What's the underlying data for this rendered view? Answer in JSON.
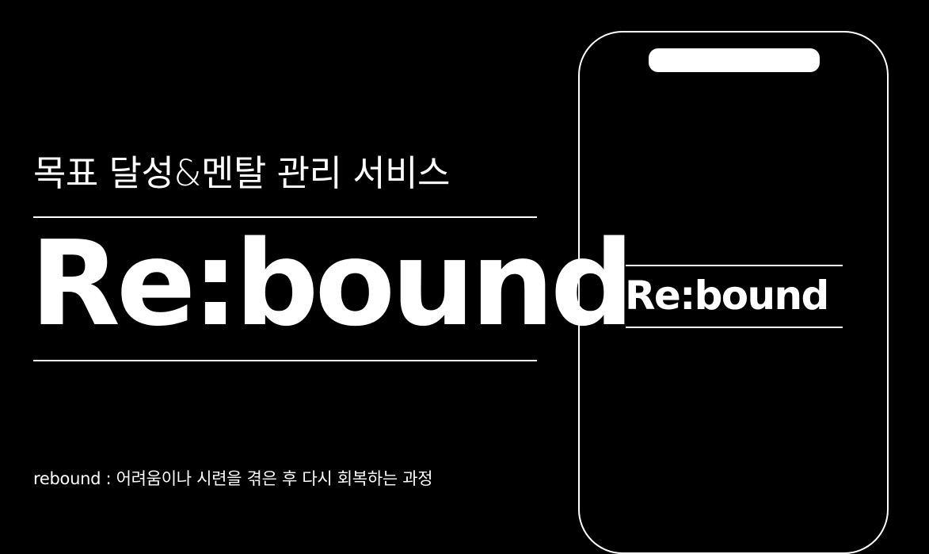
{
  "hero": {
    "subtitle": "목표 달성&멘탈 관리 서비스",
    "brand": "Re:bound",
    "definition": "rebound : 어려움이나 시련을 겪은 후 다시 회복하는 과정"
  },
  "phone": {
    "brand": "Re:bound"
  },
  "colors": {
    "background": "#000000",
    "foreground": "#ffffff"
  }
}
